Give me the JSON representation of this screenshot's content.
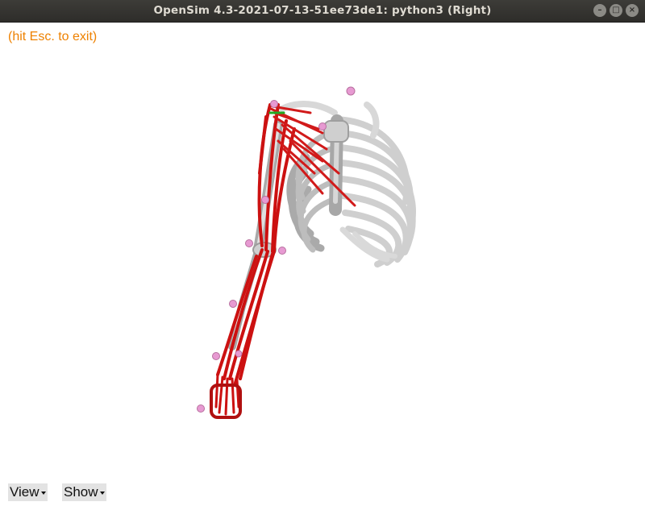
{
  "window": {
    "title": "OpenSim 4.3-2021-07-13-51ee73de1: python3 (Right)",
    "controls": [
      "minimize-icon",
      "maximize-icon",
      "close-icon"
    ]
  },
  "viewport": {
    "hint": "(hit Esc. to exit)",
    "hint_color": "#ee8100",
    "background": "#ffffff",
    "bone_color": "#d6d6d6",
    "muscle_color": "#cc1111",
    "marker_color": "#e79ad2"
  },
  "menus": {
    "view_label": "View",
    "show_label": "Show"
  }
}
